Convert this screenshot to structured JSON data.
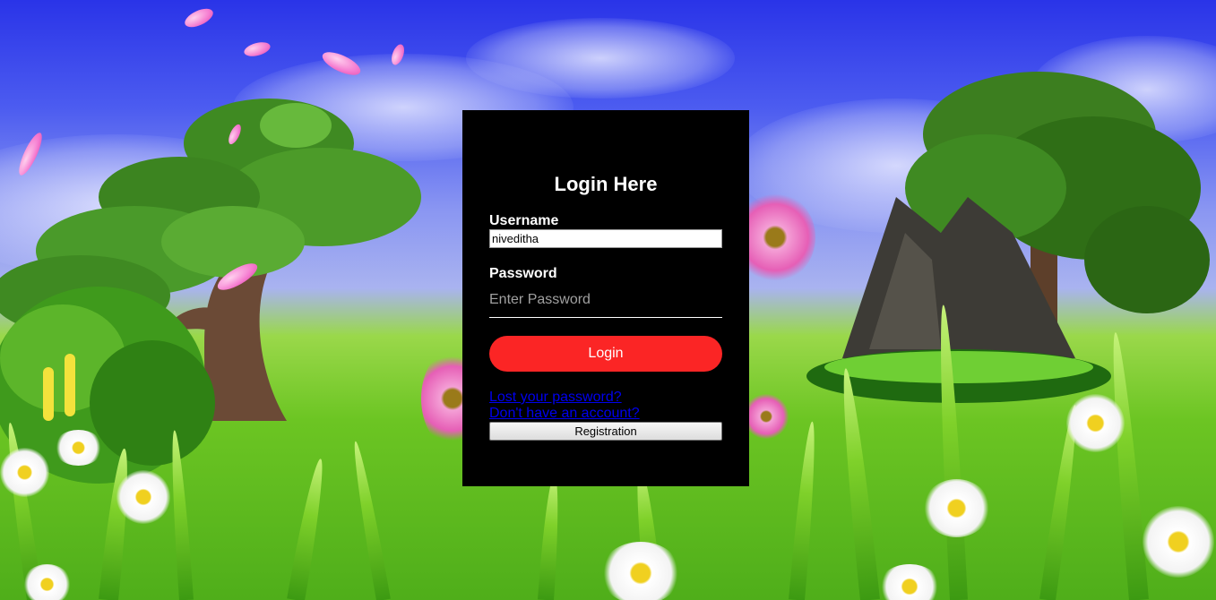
{
  "login": {
    "title": "Login Here",
    "username_label": "Username",
    "username_value": "niveditha",
    "password_label": "Password",
    "password_placeholder": "Enter Password",
    "login_button": "Login",
    "lost_password_link": "Lost your password?",
    "no_account_link": "Don't have an account?",
    "registration_button": "Registration"
  },
  "colors": {
    "panel_background": "#000000",
    "login_button": "#fb2525",
    "link": "#0000ee"
  }
}
